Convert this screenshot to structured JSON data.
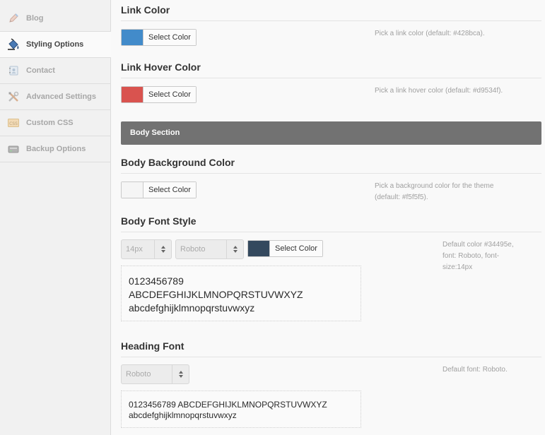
{
  "sidebar": {
    "items": [
      {
        "label": "Blog",
        "icon": "pencil-icon"
      },
      {
        "label": "Styling Options",
        "icon": "paint-bucket-icon"
      },
      {
        "label": "Contact",
        "icon": "contact-book-icon"
      },
      {
        "label": "Advanced Settings",
        "icon": "tools-icon"
      },
      {
        "label": "Custom CSS",
        "icon": "css-icon"
      },
      {
        "label": "Backup Options",
        "icon": "backup-drive-icon"
      }
    ],
    "active": "Styling Options"
  },
  "link_color": {
    "title": "Link Color",
    "button": "Select Color",
    "swatch": "#428bca",
    "help": "Pick a link color (default: #428bca)."
  },
  "link_hover_color": {
    "title": "Link Hover Color",
    "button": "Select Color",
    "swatch": "#d9534f",
    "help": "Pick a link hover color (default: #d9534f)."
  },
  "body_section": {
    "label": "Body Section"
  },
  "body_bg_color": {
    "title": "Body Background Color",
    "button": "Select Color",
    "swatch": "#f5f5f5",
    "help_line1": "Pick a background color for the theme",
    "help_line2": "(default: #f5f5f5)."
  },
  "body_font_style": {
    "title": "Body Font Style",
    "size_value": "14px",
    "font_value": "Roboto",
    "button": "Select Color",
    "swatch": "#34495e",
    "help_line1": "Default color #34495e,",
    "help_line2": "font: Roboto, font-",
    "help_line3": "size:14px",
    "preview_digits": "0123456789",
    "preview_upper": "ABCDEFGHIJKLMNOPQRSTUVWXYZ",
    "preview_lower": "abcdefghijklmnopqrstuvwxyz"
  },
  "heading_font": {
    "title": "Heading Font",
    "font_value": "Roboto",
    "help": "Default font: Roboto.",
    "preview_line1": "0123456789 ABCDEFGHIJKLMNOPQRSTUVWXYZ",
    "preview_line2": "abcdefghijklmnopqrstuvwxyz"
  }
}
